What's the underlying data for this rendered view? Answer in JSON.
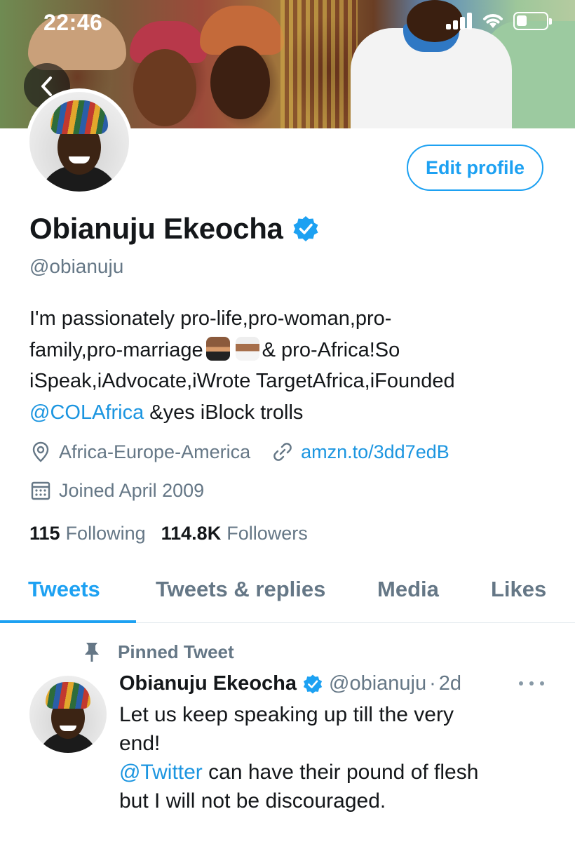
{
  "status_bar": {
    "time": "22:46"
  },
  "profile": {
    "name": "Obianuju Ekeocha",
    "handle": "@obianuju",
    "edit_button": "Edit profile",
    "bio": {
      "line1": "I'm passionately pro-life,pro-woman,pro-",
      "line2_a": "family,pro-marriage",
      "line2_b": "& pro-Africa!So",
      "line3": "iSpeak,iAdvocate,iWrote TargetAfrica,iFounded",
      "mention": "@COLAfrica",
      "line4_rest": "&yes iBlock trolls",
      "emoji_1": "man-in-tuxedo-emoji",
      "emoji_2": "bride-with-veil-emoji"
    },
    "location": "Africa-Europe-America",
    "website": "amzn.to/3dd7edB",
    "joined": "Joined April 2009",
    "following_count": "115",
    "following_label": "Following",
    "followers_count": "114.8K",
    "followers_label": "Followers"
  },
  "tabs": [
    {
      "label": "Tweets",
      "active": true
    },
    {
      "label": "Tweets & replies",
      "active": false
    },
    {
      "label": "Media",
      "active": false
    },
    {
      "label": "Likes",
      "active": false
    }
  ],
  "pinned_tweet": {
    "pinned_label": "Pinned Tweet",
    "author_name": "Obianuju Ekeocha",
    "author_handle": "@obianuju",
    "separator": "·",
    "time": "2d",
    "text_line1": "Let us keep speaking up till the very",
    "text_line2": "end!",
    "mention": "@Twitter",
    "text_line3_rest": "can have their pound of flesh",
    "text_line4": "but I will not be discouraged."
  },
  "colors": {
    "accent": "#1da1f2",
    "link": "#1b95e0",
    "secondary_text": "#657786",
    "primary_text": "#14171a"
  }
}
